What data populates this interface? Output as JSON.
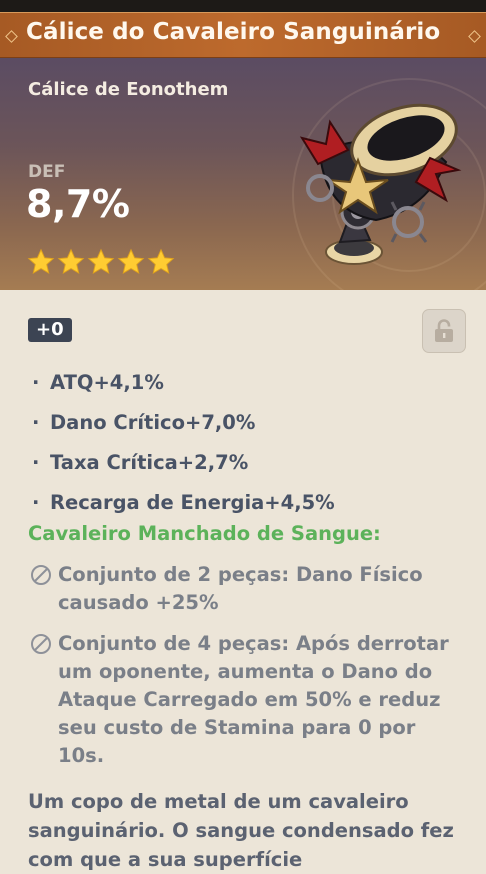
{
  "title": "Cálice do Cavaleiro Sanguinário",
  "artifact_type": "Cálice de Eonothem",
  "main_stat": {
    "label": "DEF",
    "value": "8,7%"
  },
  "rarity_stars": 5,
  "level": "+0",
  "locked": false,
  "substats": [
    {
      "bullet": "·",
      "text": "ATQ+4,1%"
    },
    {
      "bullet": "·",
      "text": "Dano Crítico+7,0%"
    },
    {
      "bullet": "·",
      "text": "Taxa Crítica+2,7%"
    },
    {
      "bullet": "·",
      "text": "Recarga de Energia+4,5%"
    }
  ],
  "set": {
    "name": "Cavaleiro Manchado de Sangue:",
    "bonuses": [
      "Conjunto de 2 peças: Dano Físico causado +25%",
      "Conjunto de 4 peças: Após derrotar um oponente, aumenta o Dano do Ataque Carregado em 50% e reduz seu custo de Stamina para 0 por 10s."
    ]
  },
  "description": "Um copo de metal de um cavaleiro sanguinário. O sangue condensado fez com que a sua superfície",
  "colors": {
    "title_bar": "#bd6a2d",
    "set_name": "#5cb25a",
    "star": "#ffcc32",
    "background": "#ece5d8"
  },
  "icons": {
    "star": "star-icon",
    "lock": "lock-open-icon",
    "set_inactive": "circle-slash-icon"
  }
}
